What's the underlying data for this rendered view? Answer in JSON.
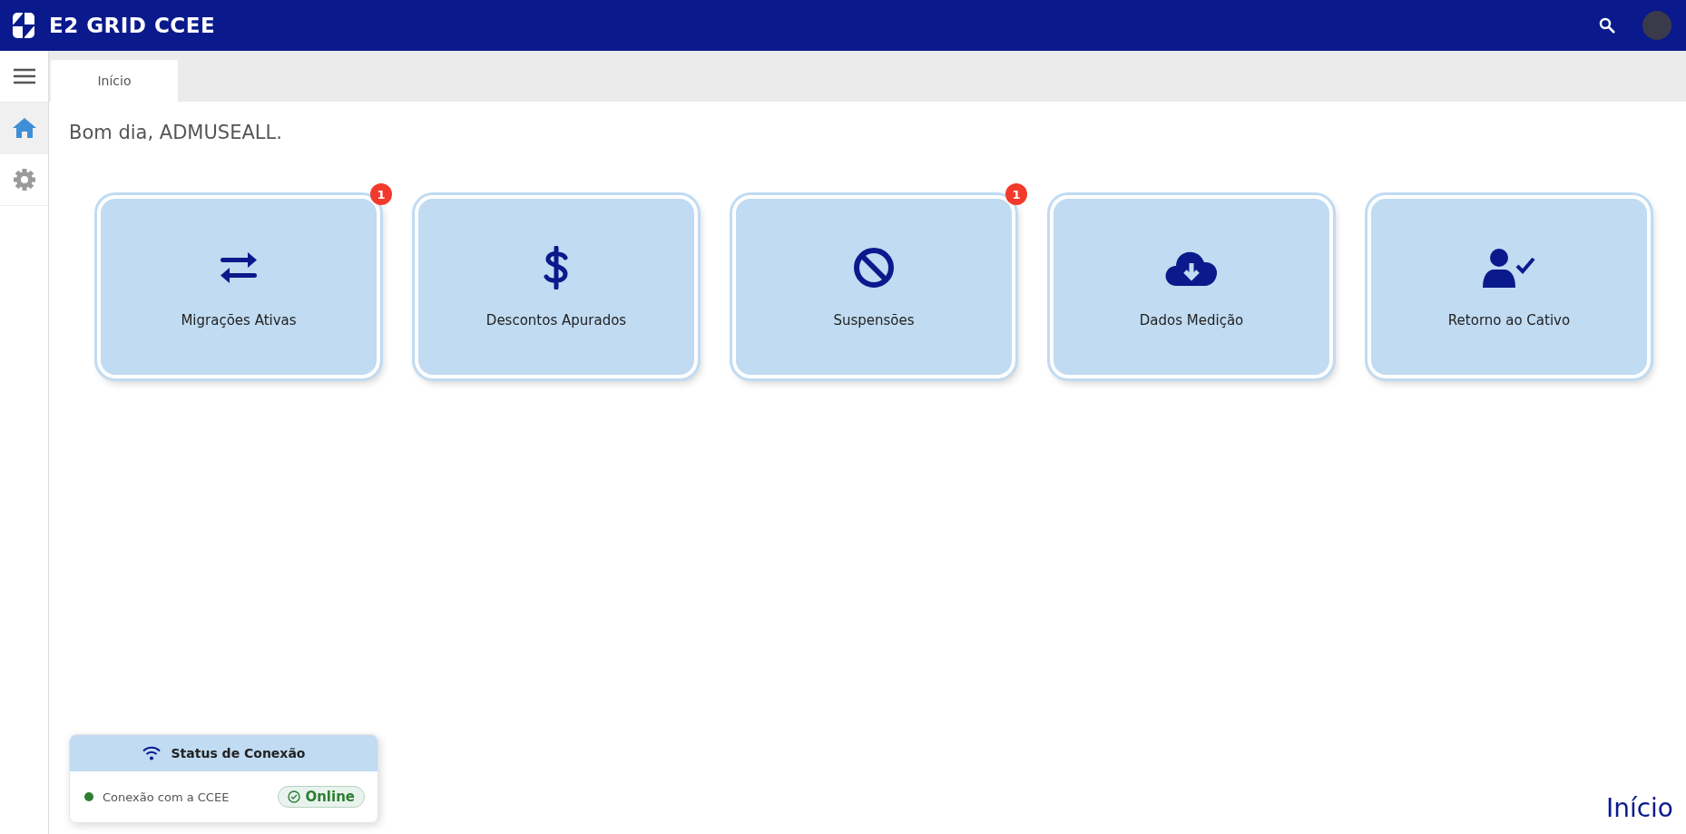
{
  "header": {
    "title": "E2 GRID CCEE"
  },
  "sidebar": {
    "items": [
      {
        "kind": "menu",
        "selected": false
      },
      {
        "kind": "home",
        "selected": true
      },
      {
        "kind": "settings",
        "selected": false
      }
    ]
  },
  "tabs": [
    {
      "label": "Início",
      "selected": true
    }
  ],
  "greeting": "Bom dia, ADMUSEALL.",
  "cards": [
    {
      "kind": "swap",
      "label": "Migrações Ativas",
      "badge": "1"
    },
    {
      "kind": "dollar",
      "label": "Descontos Apurados"
    },
    {
      "kind": "ban",
      "label": "Suspensões",
      "badge": "1"
    },
    {
      "kind": "cloud",
      "label": "Dados Medição"
    },
    {
      "kind": "user-check",
      "label": "Retorno ao Cativo"
    }
  ],
  "status_panel": {
    "title": "Status de Conexão",
    "rows": [
      {
        "label": "Conexão com a CCEE",
        "status": "Online",
        "color": "#2e7d32"
      }
    ]
  },
  "footer_label": "Início"
}
